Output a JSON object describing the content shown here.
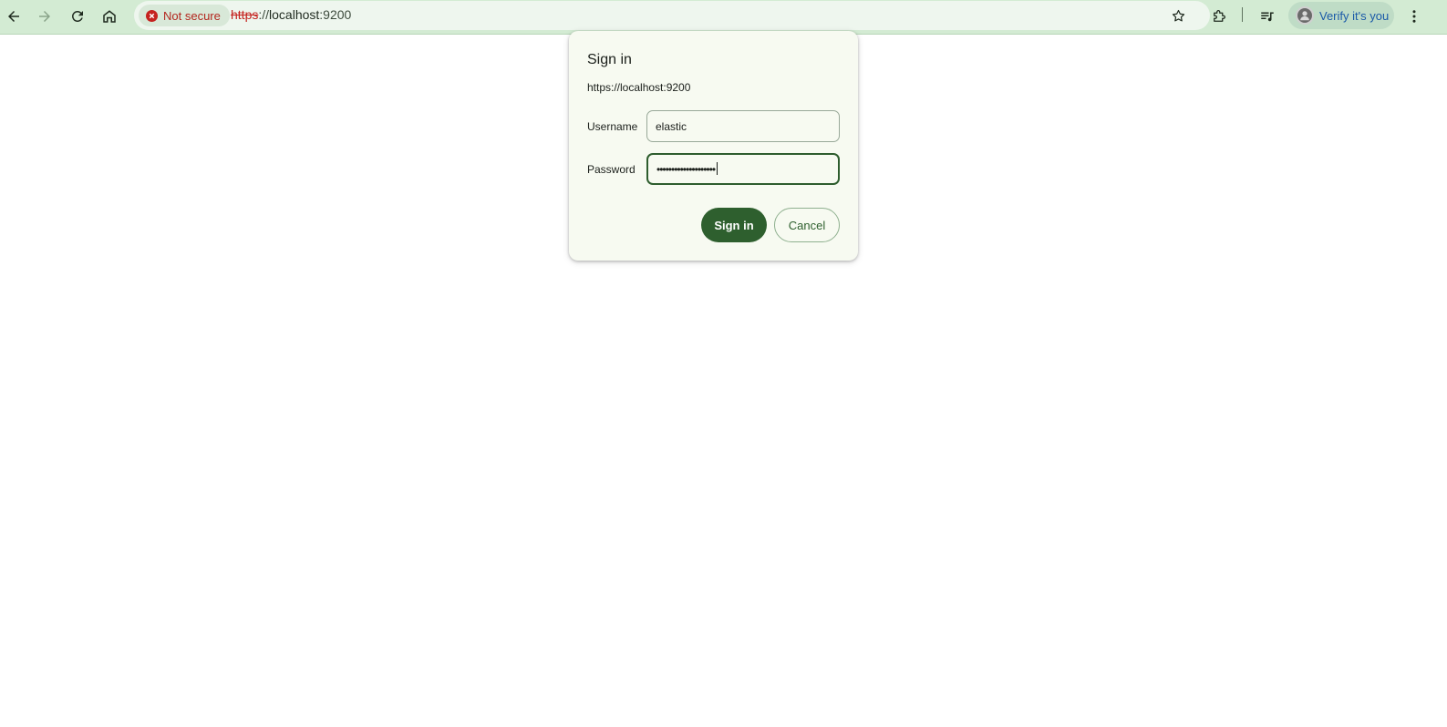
{
  "browser": {
    "security_chip": "Not secure",
    "url": {
      "scheme": "https",
      "separator": "://",
      "host": "localhost",
      "port": ":9200"
    },
    "profile_label": "Verify it's you",
    "icons": {
      "back": "back-arrow-icon",
      "forward": "forward-arrow-icon",
      "reload": "reload-icon",
      "home": "home-icon",
      "error": "error-circle-icon",
      "bookmark": "star-icon",
      "extensions": "puzzle-piece-icon",
      "media": "media-control-icon",
      "menu": "kebab-menu-icon"
    },
    "colors": {
      "toolbar": "#d3ebd3",
      "insecure_text": "#b3261e",
      "profile_text": "#1a5aa8"
    }
  },
  "dialog": {
    "title": "Sign in",
    "origin": "https://localhost:9200",
    "username_label": "Username",
    "username_value": "elastic",
    "password_label": "Password",
    "password_mask": "••••••••••••••••••••",
    "sign_in_label": "Sign in",
    "cancel_label": "Cancel",
    "colors": {
      "primary": "#2e5f2e",
      "background": "#f7faf1"
    }
  }
}
